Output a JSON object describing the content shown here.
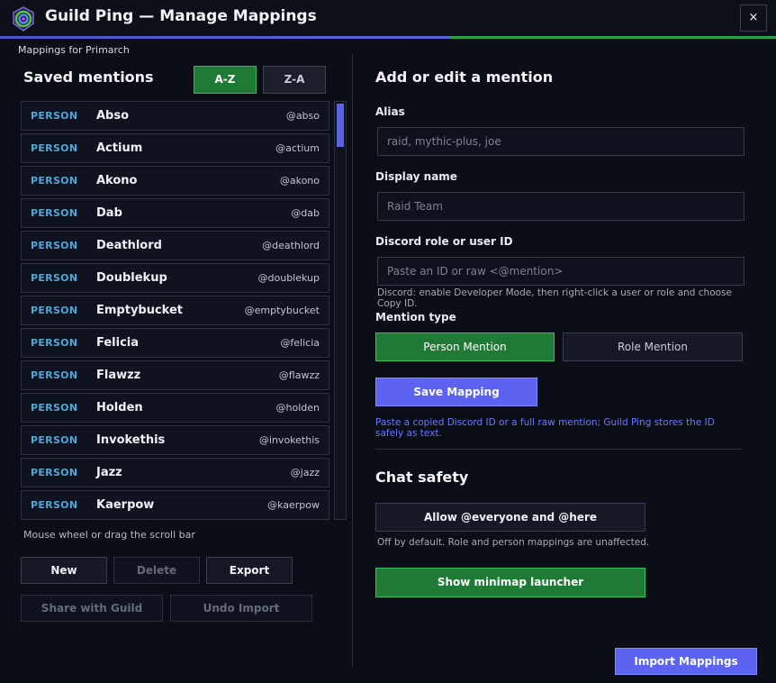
{
  "window": {
    "title": "Guild Ping — Manage Mappings",
    "close_label": "×",
    "subtitle": "Mappings for Primarch"
  },
  "colors": {
    "accent_blue": "#5b63f0",
    "accent_green": "#1e7a35",
    "kind_label": "#4fa7d8"
  },
  "left": {
    "title": "Saved mentions",
    "sort_az": "A-Z",
    "sort_za": "Z-A",
    "items": [
      {
        "kind": "PERSON",
        "name": "Abso",
        "handle": "@abso"
      },
      {
        "kind": "PERSON",
        "name": "Actium",
        "handle": "@actium"
      },
      {
        "kind": "PERSON",
        "name": "Akono",
        "handle": "@akono"
      },
      {
        "kind": "PERSON",
        "name": "Dab",
        "handle": "@dab"
      },
      {
        "kind": "PERSON",
        "name": "Deathlord",
        "handle": "@deathlord"
      },
      {
        "kind": "PERSON",
        "name": "Doublekup",
        "handle": "@doublekup"
      },
      {
        "kind": "PERSON",
        "name": "Emptybucket",
        "handle": "@emptybucket"
      },
      {
        "kind": "PERSON",
        "name": "Felicia",
        "handle": "@felicia"
      },
      {
        "kind": "PERSON",
        "name": "Flawzz",
        "handle": "@flawzz"
      },
      {
        "kind": "PERSON",
        "name": "Holden",
        "handle": "@holden"
      },
      {
        "kind": "PERSON",
        "name": "Invokethis",
        "handle": "@invokethis"
      },
      {
        "kind": "PERSON",
        "name": "Jazz",
        "handle": "@jazz"
      },
      {
        "kind": "PERSON",
        "name": "Kaerpow",
        "handle": "@kaerpow"
      }
    ],
    "scroll_hint": "Mouse wheel or drag the scroll bar",
    "new_label": "New",
    "delete_label": "Delete",
    "export_label": "Export",
    "share_label": "Share with Guild",
    "undo_label": "Undo Import"
  },
  "right": {
    "title": "Add or edit a mention",
    "alias_label": "Alias",
    "alias_placeholder": "raid, mythic-plus, joe",
    "display_label": "Display name",
    "display_placeholder": "Raid Team",
    "discord_label": "Discord role or user ID",
    "discord_placeholder": "Paste an ID or raw <@mention>",
    "discord_help": "Discord: enable Developer Mode, then right-click a user or role and choose Copy ID.",
    "mention_type_label": "Mention type",
    "person_mention": "Person Mention",
    "role_mention": "Role Mention",
    "save_label": "Save Mapping",
    "save_note": "Paste a copied Discord ID or a full raw mention; Guild Ping stores the ID safely as text.",
    "safety_title": "Chat safety",
    "allow_label": "Allow @everyone and @here",
    "allow_note": "Off by default. Role and person mappings are unaffected.",
    "minimap_label": "Show minimap launcher",
    "import_label": "Import Mappings"
  }
}
